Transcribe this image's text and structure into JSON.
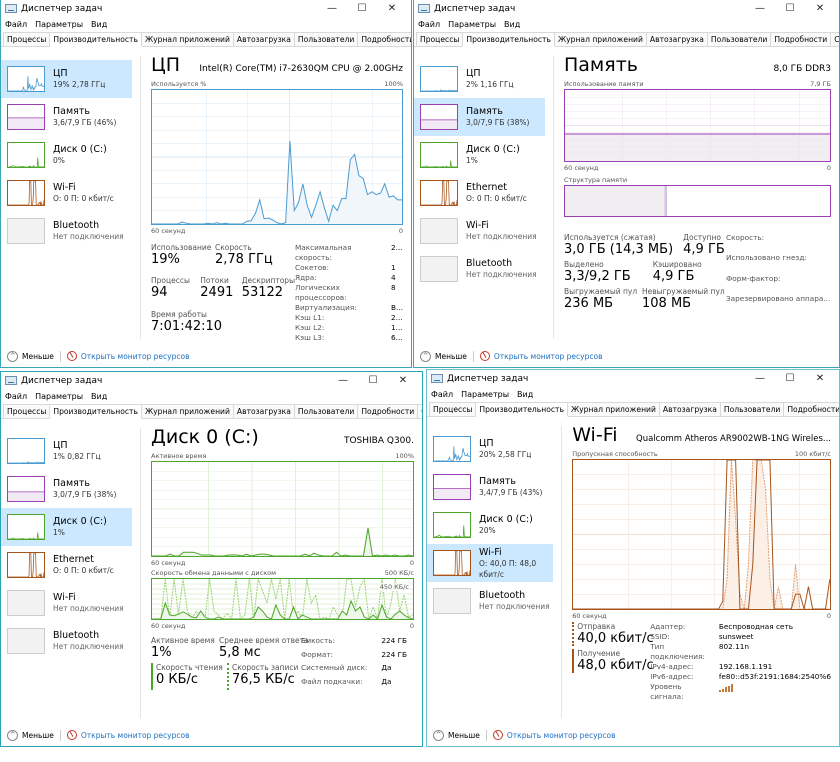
{
  "common": {
    "app_title": "Диспетчер задач",
    "window_controls": {
      "minimize": "—",
      "maximize": "☐",
      "close": "✕"
    },
    "menu": [
      "Файл",
      "Параметры",
      "Вид"
    ],
    "tabs": [
      "Процессы",
      "Производительность",
      "Журнал приложений",
      "Автозагрузка",
      "Пользователи",
      "Подробности",
      "Службы"
    ],
    "active_tab": "Производительность",
    "footer": {
      "fewer_label": "Меньше",
      "resmon_link": "Открыть монитор ресурсов"
    },
    "graph_time_left": "60 секунд",
    "graph_time_right": "0"
  },
  "windows": [
    {
      "id": "cpu",
      "sidebar": [
        {
          "name": "ЦП",
          "sub": "19% 2,78 ГГц",
          "type": "cpu",
          "selected": true
        },
        {
          "name": "Память",
          "sub": "3,6/7,9 ГБ (46%)",
          "type": "mem"
        },
        {
          "name": "Диск 0 (C:)",
          "sub": "0%",
          "type": "disk"
        },
        {
          "name": "Wi-Fi",
          "sub": "О: 0 П: 0 кбит/с",
          "type": "net"
        },
        {
          "name": "Bluetooth",
          "sub": "Нет подключения",
          "type": "none"
        }
      ],
      "header": {
        "title": "ЦП",
        "right": "Intel(R) Core(TM) i7-2630QM CPU @ 2.00GHz"
      },
      "graph": {
        "label_left": "Используется %",
        "label_right": "100%",
        "color": "#4a9bd1",
        "fill": "#f1f6fa",
        "grid": "#d9eaf7",
        "values": [
          0,
          0,
          0,
          0,
          0,
          0,
          0,
          1.5,
          0.5,
          0,
          0,
          0,
          0,
          0.5,
          0,
          1,
          0,
          0.5,
          0,
          0,
          0,
          0,
          2,
          2.5,
          8,
          18,
          4,
          4.5,
          3,
          1,
          0,
          1,
          62,
          10,
          16,
          30,
          14,
          5,
          14,
          24,
          12,
          2,
          14,
          10,
          19,
          19,
          48,
          52,
          36,
          34,
          22,
          24,
          22,
          23,
          30,
          20,
          21,
          18,
          18
        ]
      },
      "stats": {
        "usage_label": "Использование",
        "usage": "19%",
        "speed_label": "Скорость",
        "speed": "2,78 ГГц",
        "proc_label": "Процессы",
        "proc": "94",
        "threads_label": "Потоки",
        "threads": "2491",
        "handles_label": "Дескрипторы",
        "handles": "53122",
        "uptime_label": "Время работы",
        "uptime": "7:01:42:10"
      },
      "details": [
        [
          "Максимальная скорость:",
          "2..."
        ],
        [
          "Сокетов:",
          "1"
        ],
        [
          "Ядра:",
          "4"
        ],
        [
          "Логических процессоров:",
          "8"
        ],
        [
          "Виртуализация:",
          "В..."
        ],
        [
          "Кэш L1:",
          "2..."
        ],
        [
          "Кэш L2:",
          "1..."
        ],
        [
          "Кэш L3:",
          "6..."
        ]
      ]
    },
    {
      "id": "memory",
      "sidebar": [
        {
          "name": "ЦП",
          "sub": "2% 1,16 ГГц",
          "type": "cpu"
        },
        {
          "name": "Память",
          "sub": "3,0/7,9 ГБ (38%)",
          "type": "mem",
          "selected": true
        },
        {
          "name": "Диск 0 (C:)",
          "sub": "1%",
          "type": "disk"
        },
        {
          "name": "Ethernet",
          "sub": "О: 0 П: 0 кбит/с",
          "type": "net"
        },
        {
          "name": "Wi-Fi",
          "sub": "Нет подключения",
          "type": "none"
        },
        {
          "name": "Bluetooth",
          "sub": "Нет подключения",
          "type": "none"
        }
      ],
      "header": {
        "title": "Память",
        "right": "8,0 ГБ DDR3"
      },
      "graph": {
        "label_left": "Использование памяти",
        "label_right": "7,9 ГБ",
        "usage_fraction": 0.38
      },
      "composition": {
        "label": "Структура памяти",
        "in_use_fraction": 0.38
      },
      "stats": {
        "inuse_label": "Используется (сжатая)",
        "inuse": "3,0 ГБ (14,3 МБ)",
        "avail_label": "Доступно",
        "avail": "4,9 ГБ",
        "commit_label": "Выделено",
        "commit": "3,3/9,2 ГБ",
        "cached_label": "Кэшировано",
        "cached": "4,9 ГБ",
        "paged_label": "Выгружаемый пул",
        "paged": "236 МБ",
        "nonpaged_label": "Невыгружаемый пул",
        "nonpaged": "108 МБ"
      },
      "details": [
        "Скорость:",
        "Использовано гнезд:",
        "Форм-фактор:",
        "Зарезервировано аппара..."
      ]
    },
    {
      "id": "disk",
      "sidebar": [
        {
          "name": "ЦП",
          "sub": "1% 0,82 ГГц",
          "type": "cpu"
        },
        {
          "name": "Память",
          "sub": "3,0/7,9 ГБ (38%)",
          "type": "mem"
        },
        {
          "name": "Диск 0 (C:)",
          "sub": "1%",
          "type": "disk",
          "selected": true
        },
        {
          "name": "Ethernet",
          "sub": "О: 0 П: 0 кбит/с",
          "type": "net"
        },
        {
          "name": "Wi-Fi",
          "sub": "Нет подключения",
          "type": "none"
        },
        {
          "name": "Bluetooth",
          "sub": "Нет подключения",
          "type": "none"
        }
      ],
      "header": {
        "title": "Диск 0 (C:)",
        "right": "TOSHIBA Q300."
      },
      "graph": {
        "label_left": "Активное время",
        "label_right": "100%",
        "values": [
          0,
          0,
          0,
          0,
          2,
          0,
          0,
          4,
          4,
          4,
          3,
          1,
          1,
          1,
          0,
          0,
          0,
          1,
          1,
          1,
          0,
          2,
          0,
          1,
          2,
          2,
          1,
          0,
          0,
          0,
          0,
          0,
          0,
          0,
          2,
          0,
          3,
          1,
          0,
          0,
          0,
          4,
          0,
          1,
          0,
          0,
          0,
          0,
          30,
          0,
          1,
          0,
          1,
          0,
          1,
          0,
          0,
          1,
          0
        ]
      },
      "graph2": {
        "label_left": "Скорость обмена данными с диском",
        "label_right": "500 КБ/с",
        "marker": "450 КБ/с",
        "read": [
          0,
          0,
          0,
          40,
          10,
          8,
          12,
          18,
          12,
          5,
          3,
          20,
          5,
          0,
          0,
          5,
          0,
          0,
          0,
          0,
          0,
          0,
          0,
          5,
          30,
          20,
          5,
          0,
          35,
          10,
          0,
          0,
          30,
          0,
          10,
          5,
          0,
          0,
          0,
          0,
          0,
          0,
          0,
          20,
          10,
          45,
          20,
          30,
          5,
          0,
          10,
          0,
          35,
          5,
          0,
          12,
          20,
          10,
          3,
          0
        ],
        "write": [
          0,
          0,
          0,
          100,
          0,
          100,
          10,
          100,
          20,
          0,
          20,
          5,
          0,
          100,
          20,
          10,
          0,
          15,
          0,
          100,
          0,
          10,
          100,
          0,
          100,
          70,
          40,
          100,
          50,
          100,
          0,
          100,
          5,
          20,
          0,
          100,
          40,
          60,
          0,
          5,
          0,
          30,
          10,
          0,
          100,
          100,
          30,
          80,
          100,
          0,
          30,
          0,
          100,
          0,
          40,
          100,
          20,
          60,
          5,
          10
        ]
      },
      "stats": {
        "active_label": "Активное время",
        "active": "1%",
        "resp_label": "Среднее время ответа",
        "resp": "5,8 мс",
        "read_label": "Скорость чтения",
        "read": "0 КБ/с",
        "write_label": "Скорость записи",
        "write": "76,5 КБ/с"
      },
      "details": [
        [
          "Емкость:",
          "224 ГБ"
        ],
        [
          "Формат:",
          "224 ГБ"
        ],
        [
          "Системный диск:",
          "Да"
        ],
        [
          "Файл подкачки:",
          "Да"
        ]
      ]
    },
    {
      "id": "wifi",
      "sidebar": [
        {
          "name": "ЦП",
          "sub": "20% 2,58 ГГц",
          "type": "cpu"
        },
        {
          "name": "Память",
          "sub": "3,4/7,9 ГБ (43%)",
          "type": "mem"
        },
        {
          "name": "Диск 0 (C:)",
          "sub": "20%",
          "type": "disk"
        },
        {
          "name": "Wi-Fi",
          "sub": "О: 40,0 П: 48,0 кбит/с",
          "type": "net",
          "selected": true
        },
        {
          "name": "Bluetooth",
          "sub": "Нет подключения",
          "type": "none"
        }
      ],
      "header": {
        "title": "Wi-Fi",
        "right": "Qualcomm Atheros AR9002WB-1NG Wireles..."
      },
      "graph": {
        "label_left": "Пропускная способность",
        "label_right": "100 кбит/с",
        "recv": [
          0,
          0,
          0,
          0,
          0,
          0,
          0,
          0,
          0,
          0,
          0,
          0,
          0,
          0,
          0,
          0,
          0,
          0,
          0,
          0,
          0,
          0,
          0,
          0,
          0,
          0,
          0,
          0,
          0,
          0,
          0,
          0,
          0,
          0,
          0,
          5,
          100,
          100,
          100,
          0,
          0,
          0,
          30,
          100,
          100,
          100,
          100,
          0,
          0,
          0,
          0,
          0,
          10,
          10,
          0,
          15,
          0,
          0,
          0,
          0,
          20
        ],
        "send": [
          0,
          0,
          0,
          0,
          0,
          0,
          0,
          0,
          0,
          0,
          0,
          0,
          0,
          0,
          0,
          0,
          0,
          0,
          0,
          0,
          0,
          0,
          0,
          0,
          0,
          0,
          0,
          0,
          0,
          0,
          0,
          0,
          0,
          0,
          0,
          0,
          20,
          100,
          60,
          10,
          0,
          30,
          100,
          100,
          100,
          80,
          20,
          0,
          15,
          0,
          0,
          0,
          30,
          0,
          0,
          0,
          0,
          0,
          0,
          0,
          0
        ]
      },
      "stats": {
        "send_label": "Отправка",
        "send": "40,0 кбит/с",
        "recv_label": "Получение",
        "recv": "48,0 кбит/с"
      },
      "details": [
        [
          "Адаптер:",
          "Беспроводная сеть"
        ],
        [
          "SSID:",
          "sunsweet"
        ],
        [
          "Тип подключения:",
          "802.11n"
        ],
        [
          "IPv4-адрес:",
          "192.168.1.191"
        ],
        [
          "IPv6-адрес:",
          "fe80::d53f:2191:1684:2540%6"
        ],
        [
          "Уровень сигнала:",
          ""
        ]
      ],
      "signal_bars": 5
    }
  ],
  "colors": {
    "cpu": "#4a9bd1",
    "mem": "#9b3fb5",
    "disk": "#4da62b",
    "net": "#a7541b",
    "selected": "#cce8ff",
    "link": "#1d6fc2"
  }
}
